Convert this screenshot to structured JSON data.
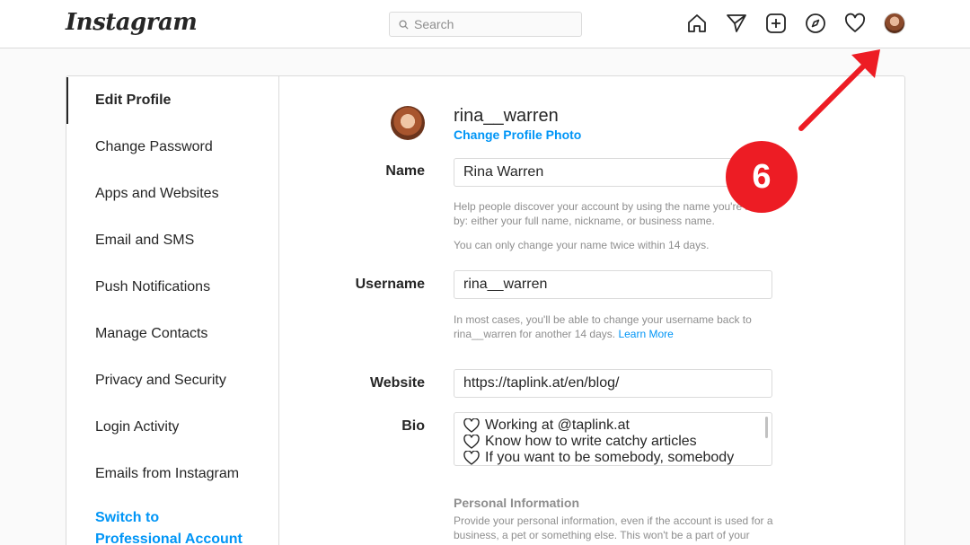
{
  "header": {
    "logo": "Instagram",
    "search_placeholder": "Search",
    "icons": [
      "home-icon",
      "direct-icon",
      "new-post-icon",
      "explore-icon",
      "activity-icon",
      "profile-avatar"
    ]
  },
  "sidebar": {
    "items": [
      {
        "label": "Edit Profile"
      },
      {
        "label": "Change Password"
      },
      {
        "label": "Apps and Websites"
      },
      {
        "label": "Email and SMS"
      },
      {
        "label": "Push Notifications"
      },
      {
        "label": "Manage Contacts"
      },
      {
        "label": "Privacy and Security"
      },
      {
        "label": "Login Activity"
      },
      {
        "label": "Emails from Instagram"
      },
      {
        "label": "Switch to Professional Account"
      }
    ]
  },
  "profile": {
    "username": "rina__warren",
    "change_photo": "Change Profile Photo"
  },
  "form": {
    "name_label": "Name",
    "name_value": "Rina Warren",
    "name_help": "Help people discover your account by using the name you're known by: either your full name, nickname, or business name.",
    "name_help2": "You can only change your name twice within 14 days.",
    "username_label": "Username",
    "username_value": "rina__warren",
    "username_help": "In most cases, you'll be able to change your username back to rina__warren for another 14 days.",
    "learn_more": "Learn More",
    "website_label": "Website",
    "website_value": "https://taplink.at/en/blog/",
    "bio_label": "Bio",
    "bio_lines": [
      "Working at @taplink.at",
      "Know how to write catchy articles",
      "If you want to be somebody, somebody"
    ],
    "personal_info_title": "Personal Information",
    "personal_info_text": "Provide your personal information, even if the account is used for a business, a pet or something else. This won't be a part of your"
  },
  "annotation": {
    "badge": "6",
    "color": "#ed1c24"
  },
  "colors": {
    "link_blue": "#0095f6",
    "border": "#dbdbdb",
    "muted": "#8e8e8e"
  }
}
